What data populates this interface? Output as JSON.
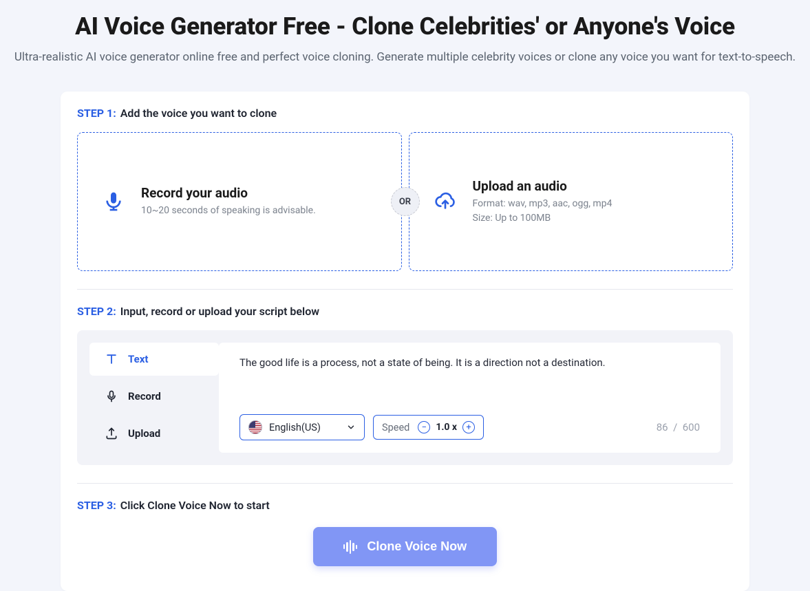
{
  "header": {
    "title": "AI Voice Generator Free - Clone Celebrities' or Anyone's Voice",
    "subtitle": "Ultra-realistic AI voice generator online free and perfect voice cloning. Generate multiple celebrity voices or clone any voice you want for text-to-speech."
  },
  "step1": {
    "label": "STEP 1:",
    "text": "Add the voice you want to clone",
    "or": "OR",
    "record": {
      "title": "Record your audio",
      "desc": "10~20 seconds of speaking is advisable."
    },
    "upload": {
      "title": "Upload an audio",
      "desc_line1": "Format: wav, mp3, aac, ogg, mp4",
      "desc_line2": "Size: Up to 100MB"
    }
  },
  "step2": {
    "label": "STEP 2:",
    "text": "Input, record or upload your script below",
    "tabs": {
      "text": "Text",
      "record": "Record",
      "upload": "Upload"
    },
    "script": "The good life is a process, not a state of being. It is a direction not a destination.",
    "language": "English(US)",
    "speed": {
      "label": "Speed",
      "value": "1.0 x"
    },
    "counter": {
      "current": "86",
      "max": "600"
    }
  },
  "step3": {
    "label": "STEP 3:",
    "text": "Click Clone Voice Now to start",
    "cta": "Clone Voice Now"
  }
}
